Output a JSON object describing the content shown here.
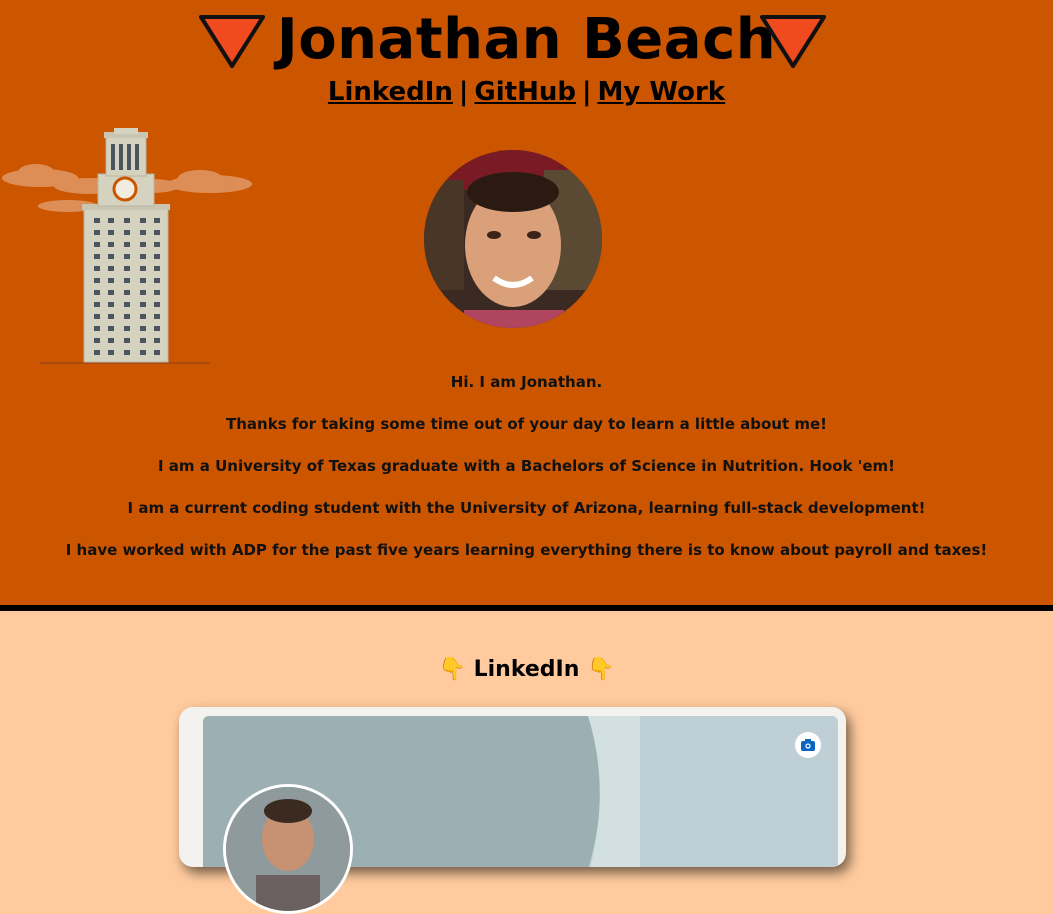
{
  "header": {
    "name": "Jonathan Beach",
    "nav": [
      {
        "label": "LinkedIn"
      },
      {
        "label": "GitHub"
      },
      {
        "label": "My Work"
      }
    ],
    "separator": "|"
  },
  "bio": {
    "lines": [
      "Hi. I am Jonathan.",
      "Thanks for taking some time out of your day to learn a little about me!",
      "I am a University of Texas graduate with a Bachelors of Science in Nutrition. Hook 'em!",
      "I am a current coding student with the University of Arizona, learning full-stack development!",
      "I have worked with ADP for the past five years learning everything there is to know about payroll and taxes!"
    ]
  },
  "linkedin_section": {
    "title": "LinkedIn",
    "hand_icon": "👇"
  },
  "icons": {
    "triangle": "down-triangle-icon",
    "tower": "ut-tower-illustration",
    "camera": "camera-icon"
  },
  "colors": {
    "hero_bg": "#cc5500",
    "lower_bg": "#ffcb9e",
    "triangle_fill": "#f04a1f",
    "divider": "#000000"
  }
}
